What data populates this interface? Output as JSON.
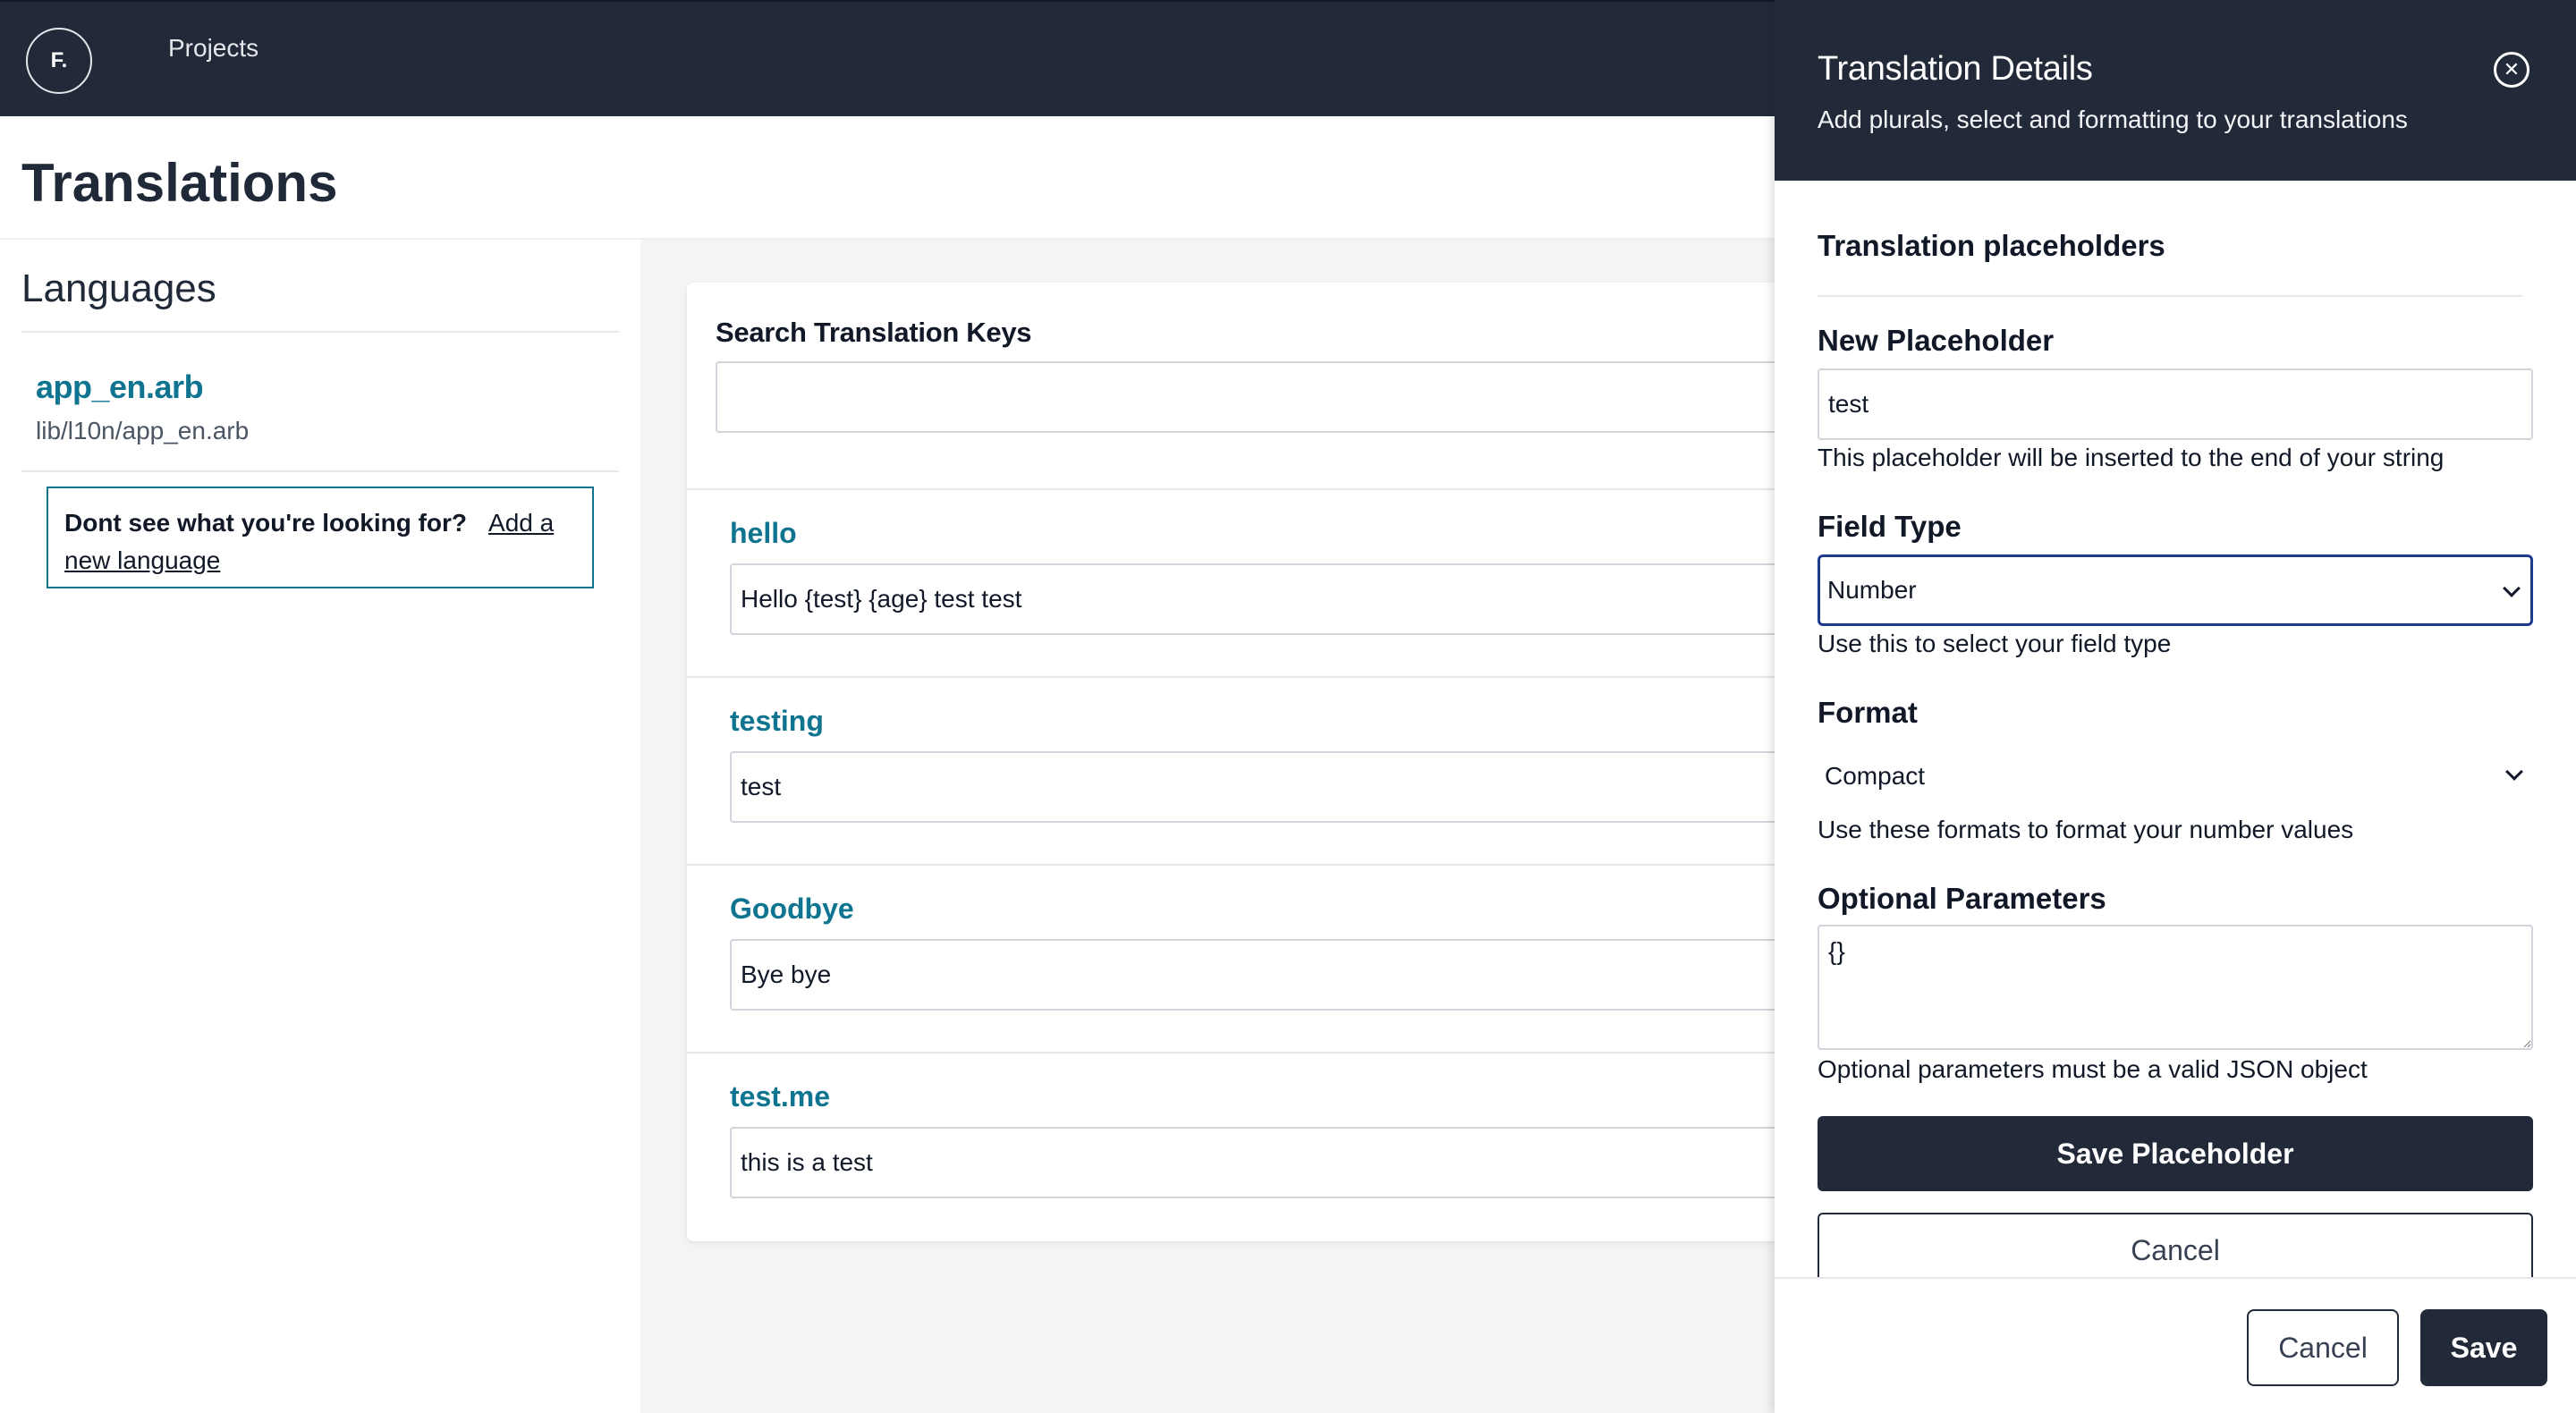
{
  "nav": {
    "logo": "F.",
    "projects_link": "Projects"
  },
  "page": {
    "title": "Translations"
  },
  "sidebar": {
    "title": "Languages",
    "language": {
      "name": "app_en.arb",
      "path": "lib/l10n/app_en.arb"
    },
    "add_prompt": {
      "question": "Dont see what you're looking for?",
      "link": "Add a new language"
    }
  },
  "main": {
    "search": {
      "label": "Search Translation Keys",
      "value": ""
    },
    "translations": [
      {
        "key": "hello",
        "value": "Hello {test} {age} test test"
      },
      {
        "key": "testing",
        "value": "test"
      },
      {
        "key": "Goodbye",
        "value": "Bye bye"
      },
      {
        "key": "test.me",
        "value": "this is a test"
      }
    ]
  },
  "panel": {
    "title": "Translation Details",
    "subtitle": "Add plurals, select and formatting to your translations",
    "close_icon": "close-circle-icon",
    "section_title": "Translation placeholders",
    "new_placeholder": {
      "label": "New Placeholder",
      "value": "test",
      "help": "This placeholder will be inserted to the end of your string"
    },
    "field_type": {
      "label": "Field Type",
      "value": "Number",
      "help": "Use this to select your field type"
    },
    "format": {
      "label": "Format",
      "value": "Compact",
      "help": "Use these formats to format your number values"
    },
    "optional_parameters": {
      "label": "Optional Parameters",
      "value": "{}",
      "help": "Optional parameters must be a valid JSON object"
    },
    "save_placeholder_label": "Save Placeholder",
    "cancel_placeholder_label": "Cancel",
    "footer": {
      "cancel_label": "Cancel",
      "save_label": "Save"
    }
  },
  "colors": {
    "nav_bg": "#222a3a",
    "accent": "#0e7490",
    "focus_border": "#1e3a8a"
  }
}
